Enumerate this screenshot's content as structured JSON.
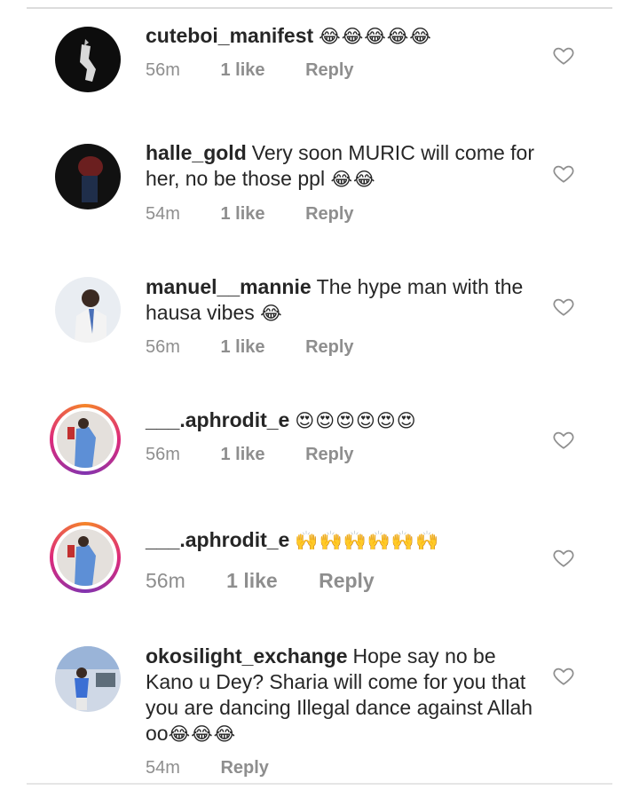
{
  "comments": [
    {
      "username": "cuteboi_manifest",
      "text": "",
      "emoji": "😂😂😂😂😂",
      "time": "56m",
      "likes": "1 like",
      "reply": "Reply"
    },
    {
      "username": "halle_gold",
      "text": "Very soon MURIC will come for her, no be those ppl",
      "emoji": "😂😂",
      "time": "54m",
      "likes": "1 like",
      "reply": "Reply"
    },
    {
      "username": "manuel__mannie",
      "text": "The hype man with the hausa vibes",
      "emoji": "😂",
      "time": "56m",
      "likes": "1 like",
      "reply": "Reply"
    },
    {
      "username": "___.aphrodit_e",
      "text": "",
      "emoji": "😍😍😍😍😍😍",
      "time": "56m",
      "likes": "1 like",
      "reply": "Reply"
    },
    {
      "username": "___.aphrodit_e",
      "text": "",
      "emoji": "🙌🙌🙌🙌🙌🙌",
      "time": "56m",
      "likes": "1 like",
      "reply": "Reply"
    },
    {
      "username": "okosilight_exchange",
      "text": "Hope say no be Kano u Dey? Sharia will come for you that you are dancing Illegal dance against Allah oo",
      "emoji": "😂😂😂",
      "time": "54m",
      "likes": "",
      "reply": "Reply"
    }
  ],
  "icons": {
    "like": "heart-outline-icon"
  },
  "colors": {
    "meta": "#8e8e8e",
    "text": "#262626",
    "story_ring_start": "#f58529",
    "story_ring_end": "#8134af"
  }
}
